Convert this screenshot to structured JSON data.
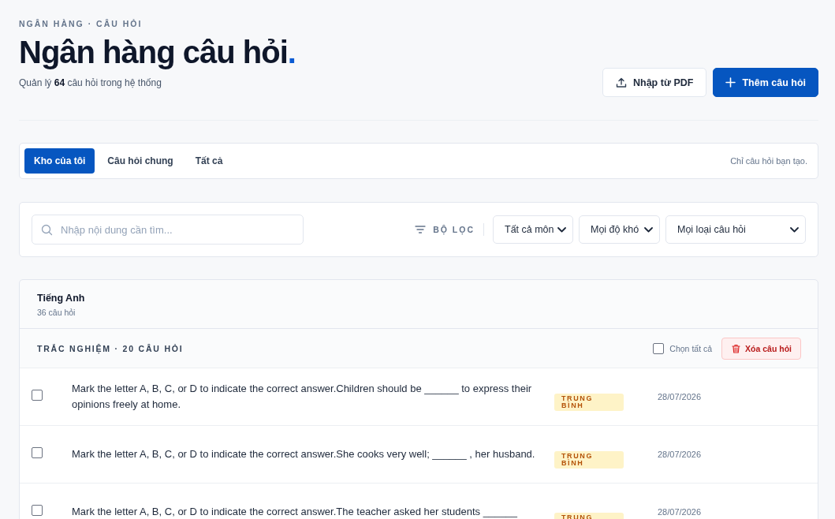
{
  "breadcrumb": "NGÂN HÀNG · CÂU HỎI",
  "title": "Ngân hàng câu hỏi",
  "title_dot": ".",
  "subtitle": "Quản lý **64** câu hỏi trong hệ thống",
  "actions": [
    {
      "label": "Nhập từ PDF",
      "kind": "import"
    },
    {
      "label": "Thêm câu hỏi",
      "kind": "add"
    }
  ],
  "tabs": [
    {
      "label": "Kho của tôi",
      "selected": true
    },
    {
      "label": "Câu hỏi chung",
      "selected": false
    },
    {
      "label": "Tất cả",
      "selected": false
    }
  ],
  "tabs_hint": "Chỉ câu hỏi bạn tạo.",
  "search": {
    "placeholder": "Nhập nội dung cần tìm..."
  },
  "filter_label": "BỘ LỌC",
  "filters": [
    "Tất cả môn",
    "Mọi độ khó",
    "Mọi loại câu hỏi"
  ],
  "subject": {
    "name": "Tiếng Anh",
    "count": "36 câu hỏi"
  },
  "section": {
    "title": "TRẮC NGHIỆM · 20 CÂU HỎI",
    "select_all": {
      "label": "Chọn tất cả",
      "checked": false
    },
    "delete_label": "Xóa câu hỏi"
  },
  "questions": [
    {
      "text": "Mark the letter A, B, C, or D to indicate the correct answer.Children should be ______ to express their opinions freely at home.",
      "difficulty": "TRUNG BÌNH",
      "date": "28/07/2026",
      "checked": false
    },
    {
      "text": "Mark the letter A, B, C, or D to indicate the correct answer.She cooks very well; ______ , her husband.",
      "difficulty": "TRUNG BÌNH",
      "date": "28/07/2026",
      "checked": false
    },
    {
      "text": "Mark the letter A, B, C, or D to indicate the correct answer.The teacher asked her students ______",
      "difficulty": "TRUNG",
      "date": "28/07/2026",
      "checked": false
    }
  ]
}
